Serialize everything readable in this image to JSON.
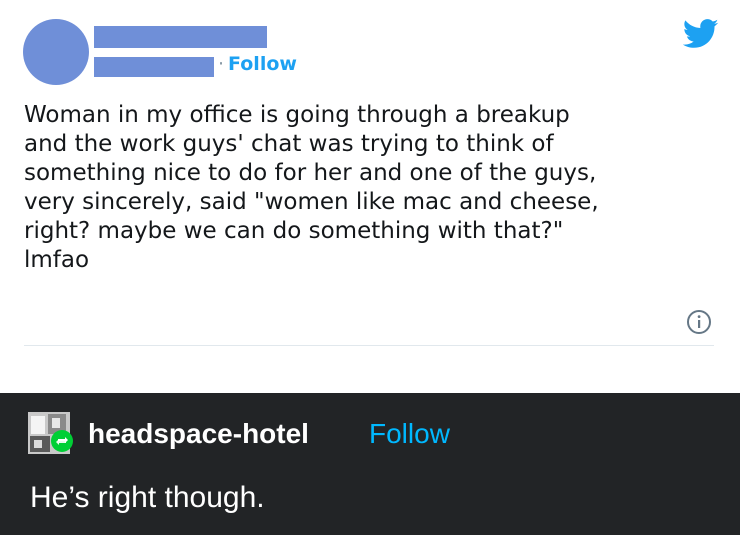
{
  "tweet": {
    "follow_separator": "·",
    "follow_label": "Follow",
    "text_lines": [
      "Woman in my office is going through a breakup",
      "and the work guys' chat was trying to think of",
      "something nice to do for her and one of the guys,",
      "very sincerely, said \"women like mac and cheese,",
      "right? maybe we can do something with that?\"",
      "lmfao"
    ],
    "icons": {
      "brand": "twitter-bird-icon",
      "info": "info-icon"
    },
    "colors": {
      "redaction": "#6f8fd8",
      "link": "#1da1f2"
    }
  },
  "reblog": {
    "username": "headspace-hotel",
    "follow_label": "Follow",
    "reply_text": "He’s right though.",
    "colors": {
      "background": "#222426",
      "follow": "#00b8ff",
      "reblog_badge": "#00cf35"
    }
  }
}
